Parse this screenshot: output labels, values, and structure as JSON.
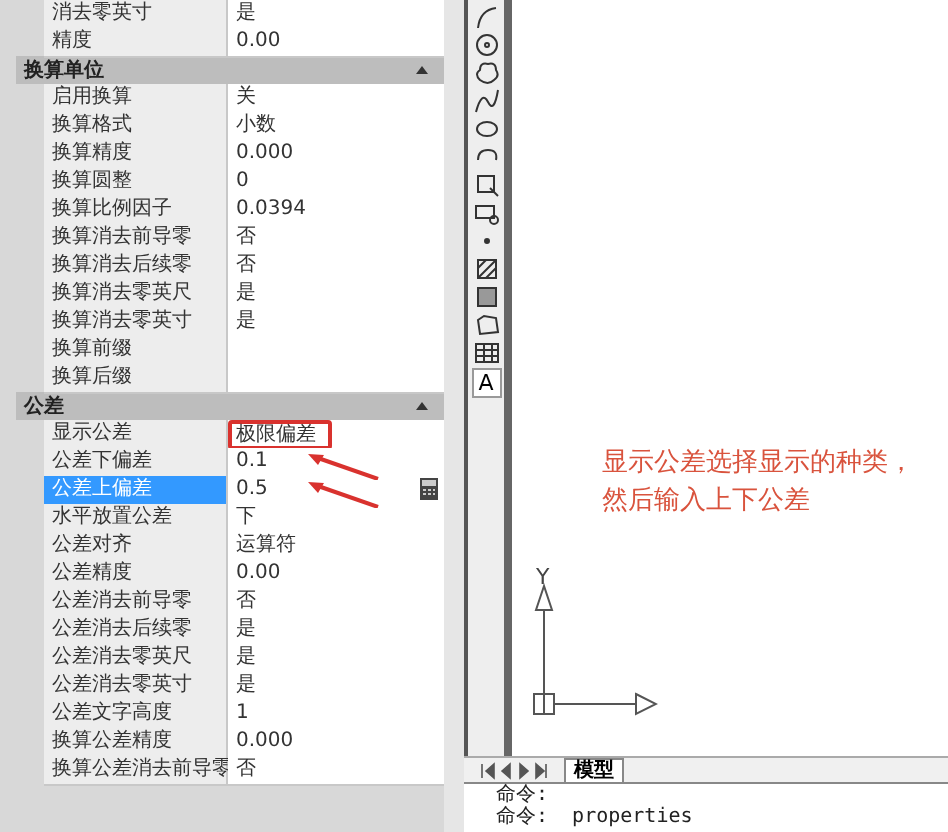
{
  "properties": {
    "top_rows": [
      {
        "label": "消去零英寸",
        "value": "是",
        "selected": false,
        "boxed": false,
        "arrow": false
      },
      {
        "label": "精度",
        "value": "0.00",
        "selected": false,
        "boxed": false,
        "arrow": false
      }
    ],
    "sections": [
      {
        "title": "换算单位",
        "expanded": true,
        "rows": [
          {
            "label": "启用换算",
            "value": "关",
            "selected": false,
            "boxed": false,
            "arrow": false
          },
          {
            "label": "换算格式",
            "value": "小数",
            "selected": false,
            "boxed": false,
            "arrow": false
          },
          {
            "label": "换算精度",
            "value": "0.000",
            "selected": false,
            "boxed": false,
            "arrow": false
          },
          {
            "label": "换算圆整",
            "value": "0",
            "selected": false,
            "boxed": false,
            "arrow": false
          },
          {
            "label": "换算比例因子",
            "value": "0.0394",
            "selected": false,
            "boxed": false,
            "arrow": false
          },
          {
            "label": "换算消去前导零",
            "value": "否",
            "selected": false,
            "boxed": false,
            "arrow": false
          },
          {
            "label": "换算消去后续零",
            "value": "否",
            "selected": false,
            "boxed": false,
            "arrow": false
          },
          {
            "label": "换算消去零英尺",
            "value": "是",
            "selected": false,
            "boxed": false,
            "arrow": false
          },
          {
            "label": "换算消去零英寸",
            "value": "是",
            "selected": false,
            "boxed": false,
            "arrow": false
          },
          {
            "label": "换算前缀",
            "value": "",
            "selected": false,
            "boxed": false,
            "arrow": false
          },
          {
            "label": "换算后缀",
            "value": "",
            "selected": false,
            "boxed": false,
            "arrow": false
          }
        ]
      },
      {
        "title": "公差",
        "expanded": true,
        "rows": [
          {
            "label": "显示公差",
            "value": "极限偏差",
            "selected": false,
            "boxed": true,
            "arrow": false
          },
          {
            "label": "公差下偏差",
            "value": "0.1",
            "selected": false,
            "boxed": false,
            "arrow": true
          },
          {
            "label": "公差上偏差",
            "value": "0.5",
            "selected": true,
            "boxed": false,
            "arrow": true
          },
          {
            "label": "水平放置公差",
            "value": "下",
            "selected": false,
            "boxed": false,
            "arrow": false
          },
          {
            "label": "公差对齐",
            "value": "运算符",
            "selected": false,
            "boxed": false,
            "arrow": false
          },
          {
            "label": "公差精度",
            "value": "0.00",
            "selected": false,
            "boxed": false,
            "arrow": false
          },
          {
            "label": "公差消去前导零",
            "value": "否",
            "selected": false,
            "boxed": false,
            "arrow": false
          },
          {
            "label": "公差消去后续零",
            "value": "是",
            "selected": false,
            "boxed": false,
            "arrow": false
          },
          {
            "label": "公差消去零英尺",
            "value": "是",
            "selected": false,
            "boxed": false,
            "arrow": false
          },
          {
            "label": "公差消去零英寸",
            "value": "是",
            "selected": false,
            "boxed": false,
            "arrow": false
          },
          {
            "label": "公差文字高度",
            "value": "1",
            "selected": false,
            "boxed": false,
            "arrow": false
          },
          {
            "label": "换算公差精度",
            "value": "0.000",
            "selected": false,
            "boxed": false,
            "arrow": false
          },
          {
            "label": "换算公差消去前导零",
            "value": "否",
            "selected": false,
            "boxed": false,
            "arrow": false
          }
        ]
      }
    ]
  },
  "toolbar": [
    {
      "kind": "arc"
    },
    {
      "kind": "circle"
    },
    {
      "kind": "cloud"
    },
    {
      "kind": "spline"
    },
    {
      "kind": "ellipse"
    },
    {
      "kind": "ellipse-arc"
    },
    {
      "kind": "insert"
    },
    {
      "kind": "block"
    },
    {
      "kind": "point"
    },
    {
      "kind": "hatch"
    },
    {
      "kind": "gradient"
    },
    {
      "kind": "region"
    },
    {
      "kind": "table"
    },
    {
      "kind": "text",
      "label": "A"
    }
  ],
  "canvas": {
    "note": [
      "显示公差选择显示的种类，",
      "然后输入上下公差"
    ],
    "ucs": {
      "y_label": "Y"
    }
  },
  "layout_tabs": [
    {
      "label": "模型",
      "selected": true
    }
  ],
  "command_lines": [
    "命令:",
    "命令:  properties"
  ]
}
